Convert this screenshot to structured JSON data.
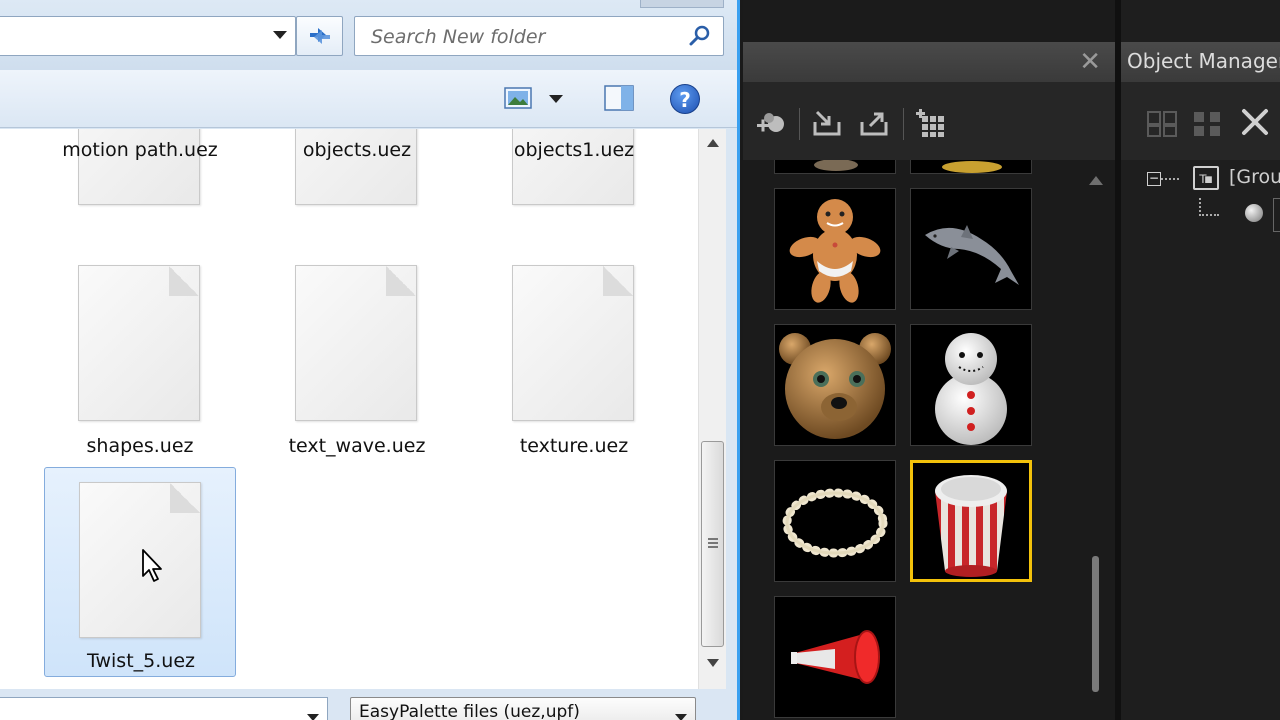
{
  "file_dialog": {
    "search_placeholder": "Search New folder",
    "files": [
      {
        "name": "motion path.uez"
      },
      {
        "name": "objects.uez"
      },
      {
        "name": "objects1.uez"
      },
      {
        "name": "shapes.uez"
      },
      {
        "name": "text_wave.uez"
      },
      {
        "name": "texture.uez"
      },
      {
        "name": "Twist_5.uez",
        "selected": true
      }
    ],
    "file_type_selected": "EasyPalette files (uez,upf)",
    "selection_color": "#cfe4fa"
  },
  "palette": {
    "close_glyph": "✕",
    "accent_color": "#f3c20b",
    "thumbnails": [
      {
        "name": "gingerbread-man"
      },
      {
        "name": "dolphin"
      },
      {
        "name": "teddy-bear-head"
      },
      {
        "name": "snowman"
      },
      {
        "name": "pearl-necklace"
      },
      {
        "name": "popcorn-bucket",
        "selected": true
      },
      {
        "name": "megaphone"
      }
    ]
  },
  "object_manager": {
    "title": "Object Manager",
    "tree_root_label": "[Group"
  }
}
